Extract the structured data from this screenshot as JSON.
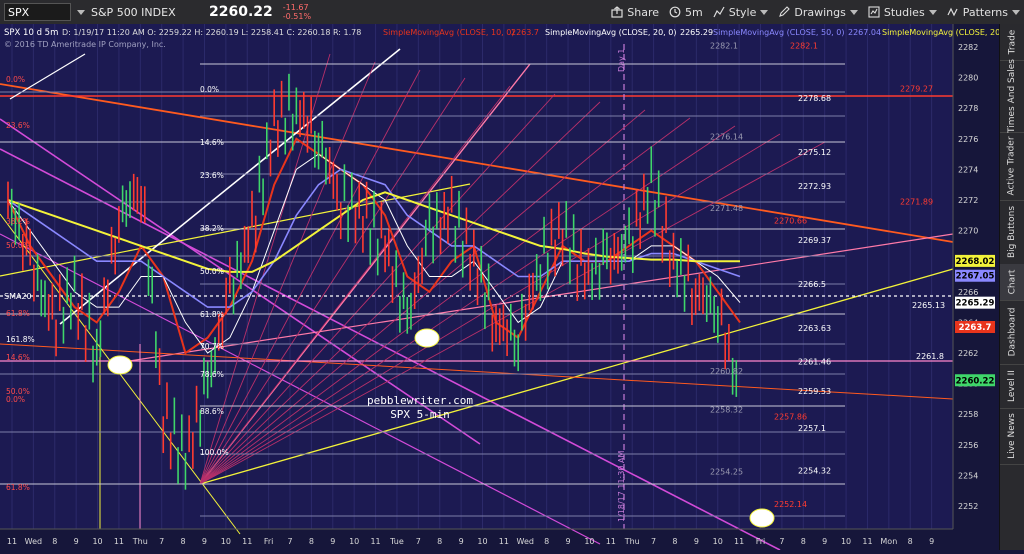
{
  "toolbar": {
    "symbol": "SPX",
    "name": "S&P 500 INDEX",
    "price": "2260.22",
    "change": "-11.67",
    "change_pct": "-0.51%",
    "share_label": "Share",
    "interval_label": "5m",
    "style_label": "Style",
    "drawings_label": "Drawings",
    "studies_label": "Studies",
    "patterns_label": "Patterns"
  },
  "sidebar": {
    "tabs": [
      "Trade",
      "Times And Sales",
      "Active Trader",
      "Big Buttons",
      "Chart",
      "Dashboard",
      "Level II",
      "Live News"
    ]
  },
  "chart_header": {
    "symbol_period": "SPX 10 d 5m",
    "ohlc": "D: 1/19/17 11:20 AM   O: 2259.22   H: 2260.19   L: 2258.41   C: 2260.18   R: 1.78",
    "copyright": "© 2016 TD Ameritrade IP Company, Inc."
  },
  "studies": [
    {
      "label": "SimpleMovingAvg (CLOSE, 10, 0)",
      "value": "2263.7",
      "color": "#e8341c"
    },
    {
      "label": "SimpleMovingAvg (CLOSE, 20, 0)",
      "value": "2265.29",
      "color": "#ffffff"
    },
    {
      "label": "SimpleMovingAvg (CLOSE, 50, 0)",
      "value": "2267.04",
      "color": "#8a88ff"
    },
    {
      "label": "SimpleMovingAvg (CLOSE, 200, 0)",
      "value": "2268.02",
      "color": "#f3f33a"
    }
  ],
  "watermark": {
    "line1": "pebblewriter.com",
    "line2": "SPX 5-min"
  },
  "annotations": {
    "day_label": "Day 1",
    "date_label": "1/18/17 11:30 AM",
    "sma20_label": "SMA20"
  },
  "fib_left_a": [
    "0.0%",
    "23.6%",
    "38.2%",
    "50.0%",
    "61.8%",
    "161.8%",
    "14.6%",
    "50.0%",
    "0.0%",
    "61.8%"
  ],
  "fib_left_b": [
    "0.0%",
    "14.6%",
    "23.6%",
    "38.2%",
    "50.0%",
    "61.8%",
    "70.7%",
    "78.6%",
    "88.6%",
    "100.0%"
  ],
  "level_labels": [
    {
      "text": "2282.1",
      "value": 2282.1,
      "color": "#9a9ab0"
    },
    {
      "text": "2282.1",
      "value": 2282.1,
      "color": "#ff3b30"
    },
    {
      "text": "2279.27",
      "value": 2279.27,
      "color": "#ff3b30"
    },
    {
      "text": "2278.68",
      "value": 2278.68,
      "color": "#ffffff"
    },
    {
      "text": "2276.14",
      "value": 2276.14,
      "color": "#9a9ab0"
    },
    {
      "text": "2275.12",
      "value": 2275.12,
      "color": "#ffffff"
    },
    {
      "text": "2272.93",
      "value": 2272.93,
      "color": "#ffffff"
    },
    {
      "text": "2271.89",
      "value": 2271.89,
      "color": "#ff3b30"
    },
    {
      "text": "2271.48",
      "value": 2271.48,
      "color": "#9a9ab0"
    },
    {
      "text": "2270.66",
      "value": 2270.66,
      "color": "#ff3b30"
    },
    {
      "text": "2269.37",
      "value": 2269.37,
      "color": "#ffffff"
    },
    {
      "text": "2266.5",
      "value": 2266.5,
      "color": "#ffffff"
    },
    {
      "text": "2265.13",
      "value": 2265.13,
      "color": "#ffffff"
    },
    {
      "text": "2263.63",
      "value": 2263.63,
      "color": "#ffffff"
    },
    {
      "text": "2261.46",
      "value": 2261.46,
      "color": "#ffffff"
    },
    {
      "text": "2261.8",
      "value": 2261.8,
      "color": "#ffffff"
    },
    {
      "text": "2260.82",
      "value": 2260.82,
      "color": "#9a9ab0"
    },
    {
      "text": "2259.53",
      "value": 2259.53,
      "color": "#ffffff"
    },
    {
      "text": "2258.32",
      "value": 2258.32,
      "color": "#9a9ab0"
    },
    {
      "text": "2257.86",
      "value": 2257.86,
      "color": "#ff3b30"
    },
    {
      "text": "2257.1",
      "value": 2257.1,
      "color": "#ffffff"
    },
    {
      "text": "2254.25",
      "value": 2254.25,
      "color": "#9a9ab0"
    },
    {
      "text": "2254.32",
      "value": 2254.32,
      "color": "#ffffff"
    },
    {
      "text": "2252.14",
      "value": 2252.14,
      "color": "#ff3b30"
    }
  ],
  "price_badges": [
    {
      "text": "2268.02",
      "value": 2268.02,
      "bg": "#f3f33a",
      "fg": "#000000"
    },
    {
      "text": "2267.05",
      "value": 2267.05,
      "bg": "#8a88ff",
      "fg": "#000000"
    },
    {
      "text": "2265.29",
      "value": 2265.29,
      "bg": "#ffffff",
      "fg": "#000000"
    },
    {
      "text": "2263.7",
      "value": 2263.7,
      "bg": "#e8341c",
      "fg": "#ffffff"
    },
    {
      "text": "2260.22",
      "value": 2260.22,
      "bg": "#3fd66a",
      "fg": "#000000"
    }
  ],
  "chart_data": {
    "type": "line",
    "title": "",
    "xlabel": "",
    "ylabel": "",
    "ylim": [
      2250.5,
      2283.5
    ],
    "y_ticks": [
      2252,
      2254,
      2256,
      2258,
      2260,
      2262,
      2264,
      2266,
      2268,
      2270,
      2272,
      2274,
      2276,
      2278,
      2280,
      2282
    ],
    "x_tick_labels": [
      "11",
      "Wed",
      "8",
      "9",
      "10",
      "11",
      "Thu",
      "7",
      "8",
      "9",
      "10",
      "11",
      "Fri",
      "7",
      "8",
      "9",
      "10",
      "11",
      "Tue",
      "7",
      "8",
      "9",
      "10",
      "11",
      "Wed",
      "8",
      "9",
      "10",
      "11",
      "Thu",
      "7",
      "8",
      "9",
      "10",
      "11",
      "Fri",
      "7",
      "8",
      "9",
      "10",
      "11",
      "Mon",
      "8",
      "9"
    ],
    "series": [
      {
        "name": "SimpleMovingAvg (CLOSE, 10, 0)",
        "values": [
          2272,
          2269,
          2267,
          2265,
          2264,
          2266,
          2269,
          2267,
          2262,
          2263,
          2265,
          2268,
          2273,
          2276,
          2275,
          2274,
          2273,
          2271,
          2267,
          2266,
          2268,
          2269,
          2264,
          2263,
          2266,
          2269,
          2268,
          2268,
          2269,
          2270,
          2269,
          2268,
          2266,
          2264
        ]
      },
      {
        "name": "SimpleMovingAvg (CLOSE, 20, 0)",
        "values": [
          2272,
          2270,
          2268,
          2266,
          2265,
          2265,
          2267,
          2267,
          2264,
          2262,
          2263,
          2266,
          2270,
          2274,
          2275,
          2274,
          2273,
          2272,
          2269,
          2267,
          2267,
          2268,
          2266,
          2264,
          2265,
          2268,
          2268,
          2268,
          2268,
          2269,
          2269,
          2268,
          2267,
          2265.3
        ]
      },
      {
        "name": "SimpleMovingAvg (CLOSE, 50, 0)",
        "values": [
          2272,
          2271,
          2270,
          2269,
          2268,
          2268,
          2268,
          2267,
          2266,
          2265,
          2265,
          2266,
          2268,
          2271,
          2273,
          2274,
          2273.5,
          2273,
          2271,
          2270,
          2269,
          2269,
          2268,
          2267,
          2267,
          2268,
          2268,
          2268,
          2268,
          2268.5,
          2268.5,
          2268,
          2267.5,
          2267
        ]
      },
      {
        "name": "SimpleMovingAvg (CLOSE, 200, 0)",
        "values": [
          2272,
          2271.5,
          2271,
          2270.5,
          2270,
          2269.5,
          2269,
          2268.5,
          2268,
          2267.5,
          2267.3,
          2267.3,
          2268,
          2269,
          2270,
          2271,
          2272,
          2272.5,
          2272,
          2271.5,
          2271,
          2270.5,
          2270,
          2269.5,
          2269,
          2268.8,
          2268.5,
          2268.3,
          2268.2,
          2268.1,
          2268.1,
          2268,
          2268,
          2268
        ]
      }
    ],
    "price": [
      2272,
      2268,
      2264,
      2266,
      2262,
      2271,
      2273,
      2258,
      2255,
      2260,
      2266,
      2270,
      2277,
      2278,
      2276,
      2272,
      2271,
      2269,
      2264,
      2270,
      2271,
      2268,
      2264,
      2263,
      2268,
      2270,
      2267,
      2268,
      2269,
      2273,
      2268,
      2266,
      2265,
      2259
    ]
  }
}
